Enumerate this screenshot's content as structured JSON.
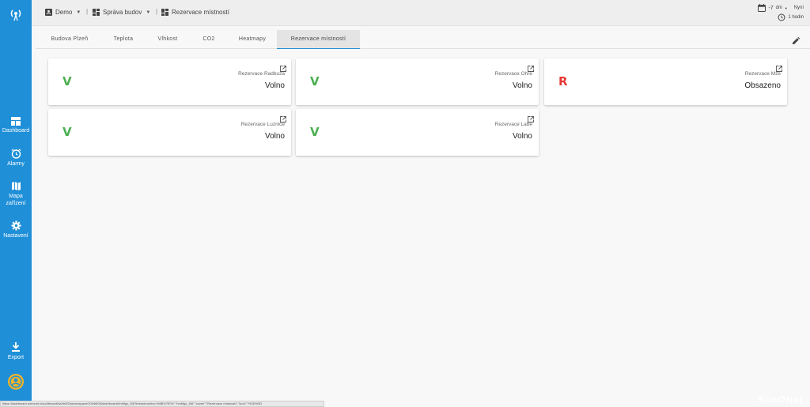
{
  "sidebar": {
    "items": [
      {
        "label": "Dashboard",
        "icon": "dashboard-icon"
      },
      {
        "label": "Alarmy",
        "icon": "alarm-clock-icon"
      },
      {
        "label": "Mapa zařízení",
        "icon": "map-icon"
      },
      {
        "label": "Nastavení",
        "icon": "gear-icon"
      }
    ],
    "export_label": "Export"
  },
  "topbar": {
    "crumbs": [
      {
        "label": "Demo"
      },
      {
        "label": "Správa budov"
      },
      {
        "label": "Rezervace místností"
      }
    ],
    "time_range": {
      "value": "-7",
      "unit": "dni",
      "end": "Nyní"
    },
    "refresh": {
      "label": "1 hodin"
    }
  },
  "tabs": [
    {
      "label": "Budova Plzeň",
      "active": false
    },
    {
      "label": "Teplota",
      "active": false
    },
    {
      "label": "Vlhkost",
      "active": false
    },
    {
      "label": "CO2",
      "active": false
    },
    {
      "label": "Heatmapy",
      "active": false
    },
    {
      "label": "Rezervace místností",
      "active": true
    }
  ],
  "widgets": [
    {
      "letter": "V",
      "title": "Rezervace Radbuza",
      "status": "Volno",
      "color": "#4caf50"
    },
    {
      "letter": "V",
      "title": "Rezervace Ohre",
      "status": "Volno",
      "color": "#4caf50"
    },
    {
      "letter": "R",
      "title": "Rezervace Mze",
      "status": "Obsazeno",
      "color": "#e53935"
    },
    {
      "letter": "V",
      "title": "Rezervace Luznice",
      "status": "Volno",
      "color": "#4caf50"
    },
    {
      "letter": "V",
      "title": "Rezervace Labe",
      "status": "Volno",
      "color": "#4caf50"
    }
  ],
  "status_url": "https://dashboard.simonet.cloud/tenant/4a/rb0f2a/workspace/20b4f605/dashboard/hmMgc_f46?breadcrumbs=%5B%7B\"id\":\"hmMgc_f46\",\"name\":\"Rezervace místností\",\"icon\":\"%3D%3D",
  "brand": "SimONet",
  "colors": {
    "sidebar": "#1f8fd8",
    "free": "#4caf50",
    "occupied": "#e53935",
    "avatar": "#f0b52a"
  }
}
